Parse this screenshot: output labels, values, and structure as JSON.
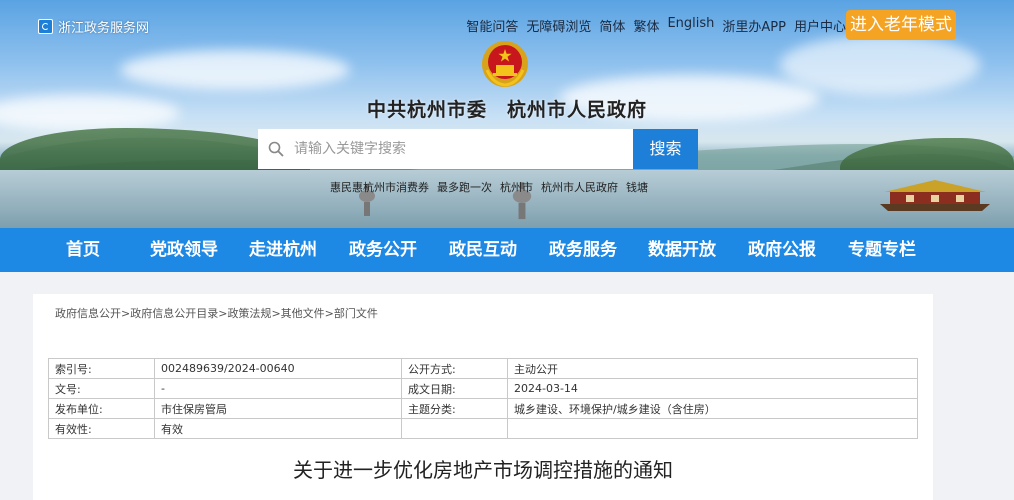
{
  "top_bar": {
    "site_name": "浙江政务服务网",
    "links": [
      "智能问答",
      "无障碍浏览",
      "简体",
      "繁体",
      "English",
      "浙里办APP",
      "用户中心"
    ],
    "elder_mode_button": "进入老年模式"
  },
  "header": {
    "title": "中共杭州市委　杭州市人民政府"
  },
  "search": {
    "placeholder": "请输入关键字搜索",
    "button_label": "搜索",
    "hot_words": [
      "惠民惠杭州市消费券",
      "最多跑一次",
      "杭州市",
      "杭州市人民政府",
      "钱塘"
    ]
  },
  "nav": {
    "items": [
      "首页",
      "党政领导",
      "走进杭州",
      "政务公开",
      "政民互动",
      "政务服务",
      "数据开放",
      "政府公报",
      "专题专栏"
    ]
  },
  "breadcrumb": [
    "政府信息公开",
    "政府信息公开目录",
    "政策法规",
    "其他文件",
    "部门文件"
  ],
  "breadcrumb_sep": ">",
  "info": {
    "rows": [
      {
        "k1": "索引号:",
        "v1": "002489639/2024-00640",
        "k2": "公开方式:",
        "v2": "主动公开"
      },
      {
        "k1": "文号:",
        "v1": "-",
        "k2": "成文日期:",
        "v2": "2024-03-14"
      },
      {
        "k1": "发布单位:",
        "v1": "市住保房管局",
        "k2": "主题分类:",
        "v2": "城乡建设、环境保护/城乡建设（含住房）"
      },
      {
        "k1": "有效性:",
        "v1": "有效",
        "k2": "",
        "v2": ""
      }
    ]
  },
  "document": {
    "title": "关于进一步优化房地产市场调控措施的通知"
  },
  "colors": {
    "nav_blue": "#1e88e5",
    "search_button": "#1d7fd8",
    "elder_button": "#f5a322"
  }
}
